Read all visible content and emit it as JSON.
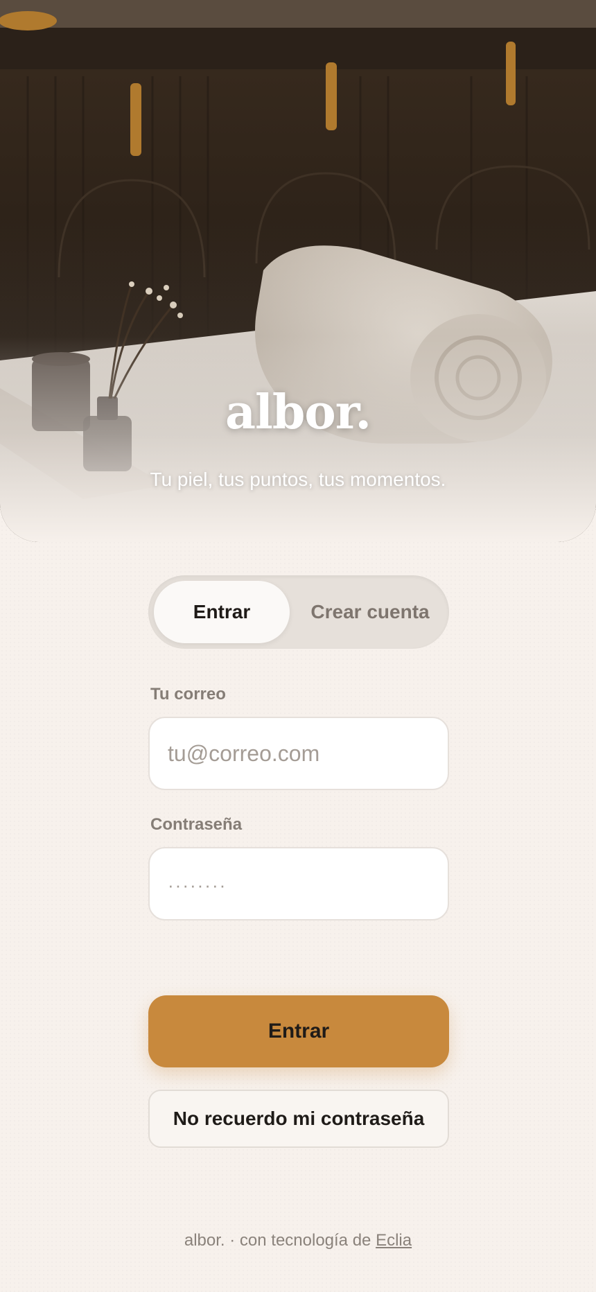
{
  "hero": {
    "brand": "albor.",
    "tagline": "Tu piel, tus puntos, tus momentos."
  },
  "auth_tabs": [
    {
      "label": "Entrar",
      "active": true
    },
    {
      "label": "Crear cuenta",
      "active": false
    }
  ],
  "form": {
    "email_label": "Tu correo",
    "email_placeholder": "tu@correo.com",
    "email_value": "",
    "password_label": "Contraseña",
    "password_placeholder": "········",
    "password_value": "",
    "submit_label": "Entrar",
    "forgot_label": "No recuerdo mi contraseña"
  },
  "footer": {
    "prefix": "albor. · con tecnología de",
    "link": "Eclia"
  },
  "colors": {
    "accent": "#c8893d",
    "background": "#f7f1ec",
    "text": "#1f1b18",
    "muted": "#857d76"
  }
}
